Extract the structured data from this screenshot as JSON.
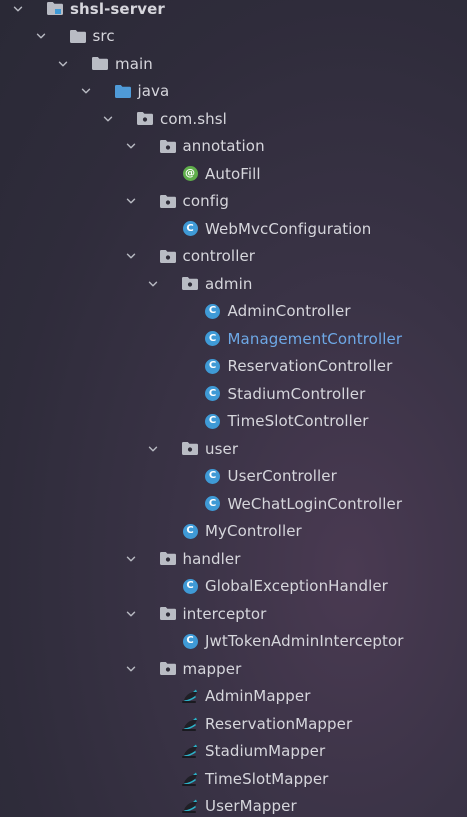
{
  "project_tree": {
    "items": [
      {
        "label": "shsl-server",
        "type": "module",
        "depth": 0,
        "expanded": true,
        "bold": true
      },
      {
        "label": "src",
        "type": "folder",
        "depth": 1,
        "expanded": true
      },
      {
        "label": "main",
        "type": "folder",
        "depth": 2,
        "expanded": true
      },
      {
        "label": "java",
        "type": "source-root",
        "depth": 3,
        "expanded": true
      },
      {
        "label": "com.shsl",
        "type": "package",
        "depth": 4,
        "expanded": true
      },
      {
        "label": "annotation",
        "type": "package",
        "depth": 5,
        "expanded": true
      },
      {
        "label": "AutoFill",
        "type": "annotation",
        "depth": 6
      },
      {
        "label": "config",
        "type": "package",
        "depth": 5,
        "expanded": true
      },
      {
        "label": "WebMvcConfiguration",
        "type": "class",
        "depth": 6
      },
      {
        "label": "controller",
        "type": "package",
        "depth": 5,
        "expanded": true
      },
      {
        "label": "admin",
        "type": "package",
        "depth": 6,
        "expanded": true
      },
      {
        "label": "AdminController",
        "type": "class",
        "depth": 7
      },
      {
        "label": "ManagementController",
        "type": "class",
        "depth": 7,
        "highlight": true
      },
      {
        "label": "ReservationController",
        "type": "class",
        "depth": 7
      },
      {
        "label": "StadiumController",
        "type": "class",
        "depth": 7
      },
      {
        "label": "TimeSlotController",
        "type": "class",
        "depth": 7
      },
      {
        "label": "user",
        "type": "package",
        "depth": 6,
        "expanded": true
      },
      {
        "label": "UserController",
        "type": "class",
        "depth": 7
      },
      {
        "label": "WeChatLoginController",
        "type": "class",
        "depth": 7
      },
      {
        "label": "MyController",
        "type": "class",
        "depth": 6
      },
      {
        "label": "handler",
        "type": "package",
        "depth": 5,
        "expanded": true
      },
      {
        "label": "GlobalExceptionHandler",
        "type": "class",
        "depth": 6
      },
      {
        "label": "interceptor",
        "type": "package",
        "depth": 5,
        "expanded": true
      },
      {
        "label": "JwtTokenAdminInterceptor",
        "type": "class",
        "depth": 6
      },
      {
        "label": "mapper",
        "type": "package",
        "depth": 5,
        "expanded": true
      },
      {
        "label": "AdminMapper",
        "type": "mapper",
        "depth": 6
      },
      {
        "label": "ReservationMapper",
        "type": "mapper",
        "depth": 6
      },
      {
        "label": "StadiumMapper",
        "type": "mapper",
        "depth": 6
      },
      {
        "label": "TimeSlotMapper",
        "type": "mapper",
        "depth": 6
      },
      {
        "label": "UserMapper",
        "type": "mapper",
        "depth": 6
      }
    ]
  },
  "icon_glyphs": {
    "class": "C",
    "annotation": "@"
  },
  "colors": {
    "text": "#d6d6dc",
    "highlight_text": "#6ea8e6",
    "folder": "#b9bcc4",
    "source_root": "#4f9bd8",
    "class_icon": "#3f9ad6",
    "annotation_icon": "#5fae4b"
  }
}
